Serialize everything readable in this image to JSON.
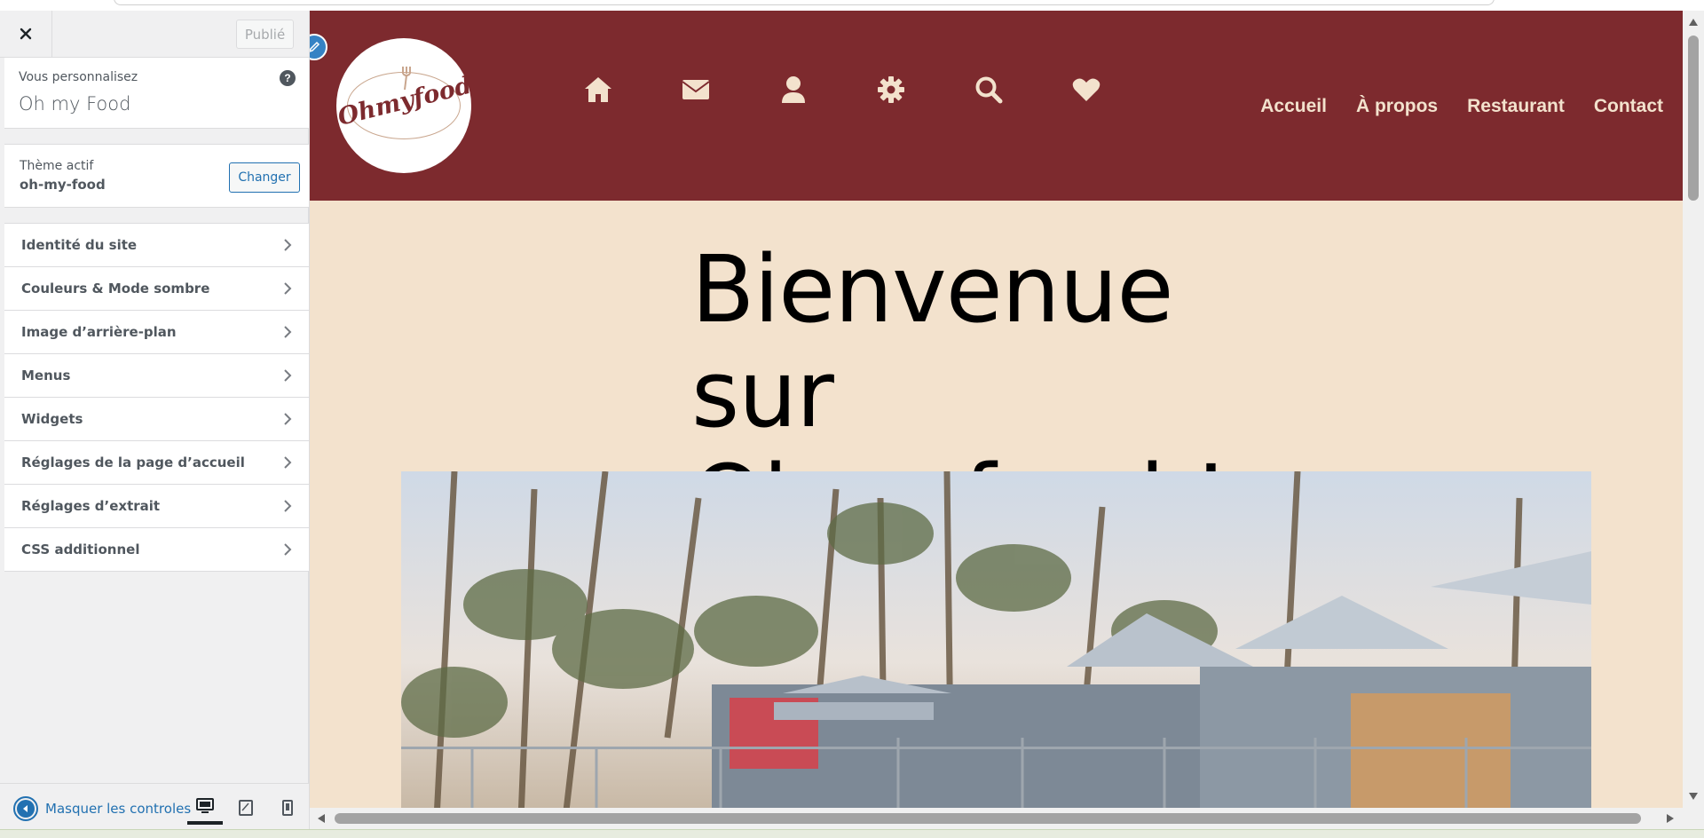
{
  "toolbar": {
    "close_label": "×",
    "publish_label": "Publié"
  },
  "customizing": {
    "label": "Vous personnalisez",
    "site_name": "Oh my Food",
    "help_label": "?"
  },
  "theme": {
    "label": "Thème actif",
    "name": "oh-my-food",
    "change_label": "Changer"
  },
  "menu": {
    "items": [
      {
        "label": "Identité du site"
      },
      {
        "label": "Couleurs & Mode sombre"
      },
      {
        "label": "Image d’arrière-plan"
      },
      {
        "label": "Menus"
      },
      {
        "label": "Widgets"
      },
      {
        "label": "Réglages de la page d’accueil"
      },
      {
        "label": "Réglages d’extrait"
      },
      {
        "label": "CSS additionnel"
      }
    ]
  },
  "footer": {
    "collapse_label": "Masquer les controles",
    "devices": [
      "desktop-icon",
      "tablet-icon",
      "mobile-icon"
    ],
    "active_device": "desktop"
  },
  "site": {
    "logo_text": "Ohmyfood",
    "icon_nav": [
      "home-icon",
      "envelope-icon",
      "user-icon",
      "gear-icon",
      "search-icon",
      "heart-icon"
    ],
    "nav": [
      "Accueil",
      "À propos",
      "Restaurant",
      "Contact"
    ],
    "hero_title_line1": "Bienvenue sur",
    "hero_title_line2": "Ohmyfood !"
  },
  "colors": {
    "header_bg": "#7d2a2e",
    "page_bg": "#f3e2cd",
    "accent": "#2271b1",
    "nav_text": "#f3e2cd"
  }
}
